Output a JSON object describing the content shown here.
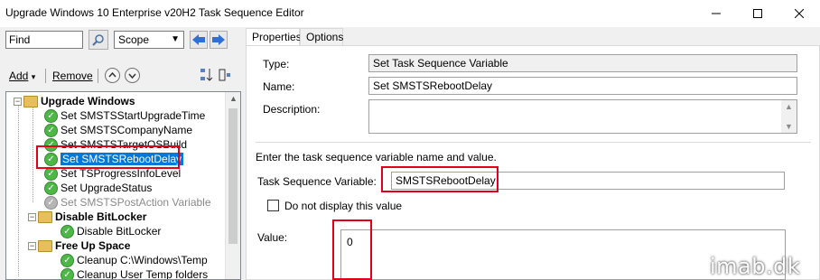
{
  "window": {
    "title": "Upgrade Windows 10 Enterprise v20H2 Task Sequence Editor"
  },
  "search": {
    "find_value": "Find",
    "scope_value": "Scope"
  },
  "toolbar": {
    "add_label": "Add",
    "remove_label": "Remove"
  },
  "tree": {
    "root": "Upgrade Windows",
    "items": [
      {
        "label": "Set SMSTSStartUpgradeTime",
        "state": "enabled"
      },
      {
        "label": "Set SMSTSCompanyName",
        "state": "enabled"
      },
      {
        "label": "Set SMSTSTargetOSBuild",
        "state": "enabled"
      },
      {
        "label": "Set SMSTSRebootDelay",
        "state": "selected"
      },
      {
        "label": "Set TSProgressInfoLevel",
        "state": "enabled"
      },
      {
        "label": "Set UpgradeStatus",
        "state": "enabled"
      },
      {
        "label": "Set SMSTSPostAction Variable",
        "state": "disabled"
      }
    ],
    "group_bitlocker": "Disable BitLocker",
    "bitlocker_child": "Disable BitLocker",
    "group_freeup": "Free Up Space",
    "freeup_children": [
      "Cleanup C:\\Windows\\Temp",
      "Cleanup User Temp folders"
    ]
  },
  "tabs": {
    "properties": "Properties",
    "options": "Options"
  },
  "properties": {
    "type_label": "Type:",
    "type_value": "Set Task Sequence Variable",
    "name_label": "Name:",
    "name_value": "Set SMSTSRebootDelay",
    "description_label": "Description:",
    "description_value": "",
    "instruction": "Enter the task sequence variable name and value.",
    "variable_label": "Task Sequence Variable:",
    "variable_value": "SMSTSRebootDelay",
    "hide_checkbox_label": "Do not display this value",
    "hide_checkbox_checked": false,
    "value_label": "Value:",
    "value_value": "0"
  },
  "watermark": "imab.dk",
  "colors": {
    "highlight_border": "#e0001b",
    "selection": "#0078d7",
    "check_green": "#4db848"
  }
}
